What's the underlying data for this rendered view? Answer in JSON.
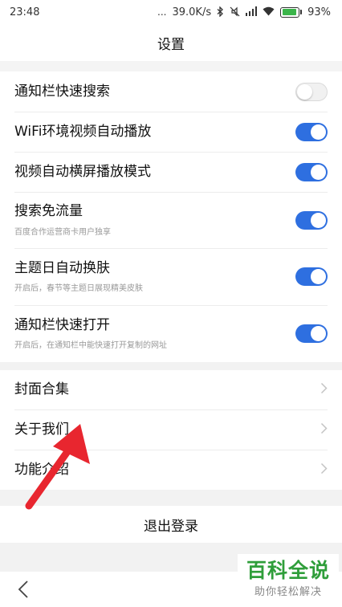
{
  "status_bar": {
    "time": "23:48",
    "dots": "...",
    "network_speed": "39.0K/s",
    "battery_percent": "93%",
    "battery_level": 0.93,
    "icons": [
      "bluetooth-icon",
      "mute-icon",
      "signal-icon",
      "wifi-icon",
      "battery-icon"
    ]
  },
  "header": {
    "title": "设置"
  },
  "toggles": [
    {
      "label": "通知栏快速搜索",
      "sub": "",
      "on": false
    },
    {
      "label": "WiFi环境视频自动播放",
      "sub": "",
      "on": true
    },
    {
      "label": "视频自动横屏播放模式",
      "sub": "",
      "on": true
    },
    {
      "label": "搜索免流量",
      "sub": "百度合作运营商卡用户独享",
      "on": true
    },
    {
      "label": "主题日自动换肤",
      "sub": "开启后，春节等主题日展现精美皮肤",
      "on": true
    },
    {
      "label": "通知栏快速打开",
      "sub": "开启后，在通知栏中能快速打开复制的网址",
      "on": true
    }
  ],
  "links": [
    {
      "label": "封面合集"
    },
    {
      "label": "关于我们"
    },
    {
      "label": "功能介绍"
    }
  ],
  "logout": {
    "label": "退出登录"
  },
  "watermark": {
    "main": "百科全说",
    "sub": "助你轻松解决"
  },
  "colors": {
    "toggle_on": "#2e6fe0",
    "accent_green": "#2f9e3a",
    "arrow_red": "#e8262f"
  }
}
